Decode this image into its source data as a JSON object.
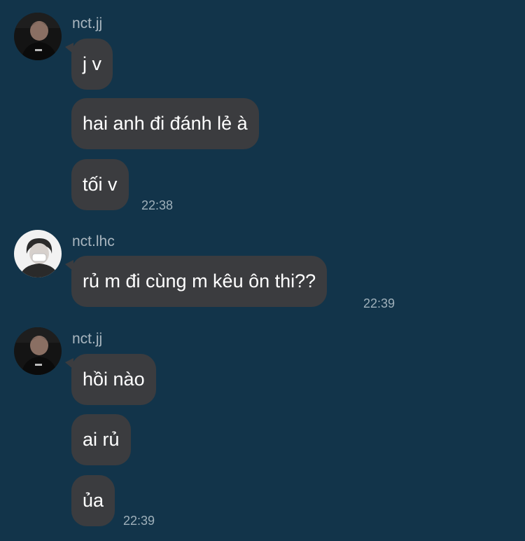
{
  "chat": {
    "groups": [
      {
        "sender": "nct.jj",
        "avatar": "avatar-jj",
        "messages": [
          "j v",
          "hai anh đi đánh lẻ à",
          "tối v"
        ],
        "time": "22:38"
      },
      {
        "sender": "nct.lhc",
        "avatar": "avatar-lhc",
        "messages": [
          "rủ m đi cùng m kêu ôn thi??"
        ],
        "time": "22:39"
      },
      {
        "sender": "nct.jj",
        "avatar": "avatar-jj",
        "messages": [
          "hồi nào",
          "ai rủ",
          "ủa"
        ],
        "time": "22:39"
      }
    ]
  },
  "colors": {
    "background": "#12344a",
    "bubble": "#3b3c3f",
    "text": "#ffffff",
    "name": "#a9b6bf",
    "timestamp": "#9fb0ba"
  }
}
